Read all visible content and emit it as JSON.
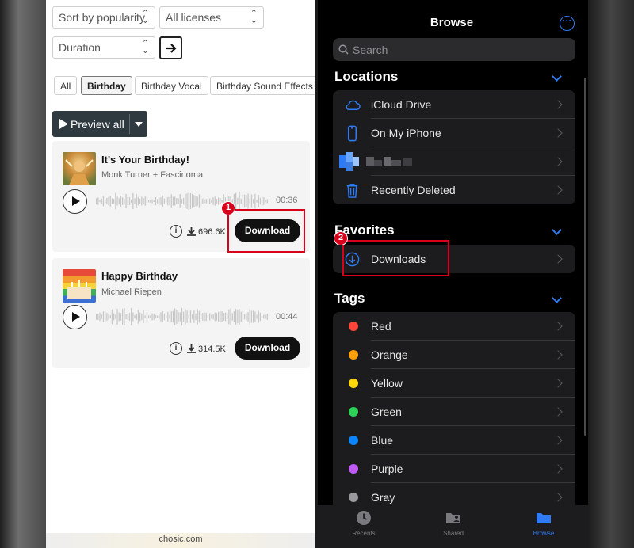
{
  "left": {
    "sort": "Sort by popularity",
    "license": "All licenses",
    "duration": "Duration",
    "chips": [
      "All",
      "Birthday",
      "Birthday Vocal",
      "Birthday Sound Effects"
    ],
    "preview_label": "Preview all",
    "tracks": [
      {
        "title": "It's Your Birthday!",
        "artist": "Monk Turner + Fascinoma",
        "time": "00:36",
        "downloads": "696.6K",
        "button": "Download"
      },
      {
        "title": "Happy Birthday",
        "artist": "Michael Riepen",
        "time": "00:44",
        "downloads": "314.5K",
        "button": "Download"
      }
    ],
    "footer": "chosic.com",
    "badge1": "1"
  },
  "right": {
    "title": "Browse",
    "search_placeholder": "Search",
    "locations_header": "Locations",
    "locations": [
      "iCloud Drive",
      "On My iPhone",
      "",
      "Recently Deleted"
    ],
    "favorites_header": "Favorites",
    "favorites": [
      "Downloads"
    ],
    "tags_header": "Tags",
    "tags": [
      {
        "label": "Red",
        "color": "#ff453a"
      },
      {
        "label": "Orange",
        "color": "#ff9f0a"
      },
      {
        "label": "Yellow",
        "color": "#ffd60a"
      },
      {
        "label": "Green",
        "color": "#30d158"
      },
      {
        "label": "Blue",
        "color": "#0a84ff"
      },
      {
        "label": "Purple",
        "color": "#bf5af2"
      },
      {
        "label": "Gray",
        "color": "#98989d"
      }
    ],
    "tabs": [
      "Recents",
      "Shared",
      "Browse"
    ],
    "badge2": "2",
    "accent": "#2f7bf5"
  }
}
